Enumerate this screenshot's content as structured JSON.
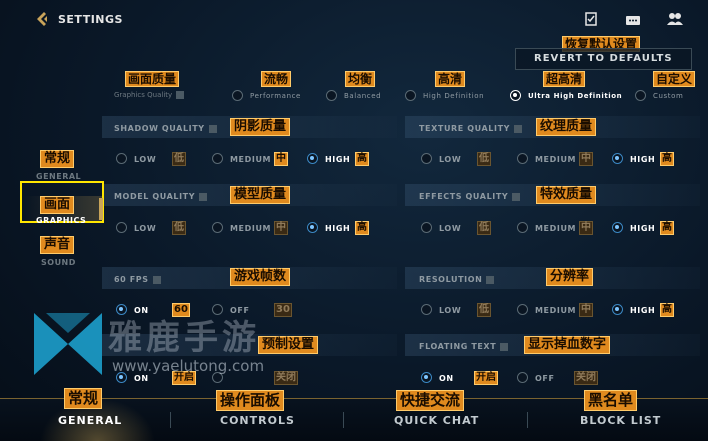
{
  "header": {
    "title": "SETTINGS",
    "revert_label": "REVERT TO DEFAULTS",
    "revert_zh": "恢复默认设置",
    "icons": [
      "checklist-icon",
      "chat-icon",
      "friends-icon"
    ]
  },
  "graphics_quality": {
    "zh": "画面质量",
    "en": "Graphics Quality",
    "options": [
      {
        "zh": "流畅",
        "en": "Performance"
      },
      {
        "zh": "均衡",
        "en": "Balanced"
      },
      {
        "zh": "高清",
        "en": "High Definition"
      },
      {
        "zh": "超高清",
        "en": "Ultra High Definition"
      },
      {
        "zh": "自定义",
        "en": "Custom"
      }
    ],
    "selected": "Ultra High Definition"
  },
  "levels": {
    "low": "LOW",
    "medium": "MEDIUM",
    "high": "HIGH",
    "low_zh": "低",
    "medium_zh": "中",
    "high_zh": "高"
  },
  "shadow": {
    "en": "SHADOW QUALITY",
    "zh": "阴影质量"
  },
  "texture": {
    "en": "TEXTURE QUALITY",
    "zh": "纹理质量"
  },
  "model": {
    "en": "MODEL QUALITY",
    "zh": "模型质量"
  },
  "effects": {
    "en": "EFFECTS QUALITY",
    "zh": "特效质量"
  },
  "fps": {
    "en": "60 FPS",
    "zh": "游戏帧数",
    "on": "ON",
    "on_zh": "60",
    "off": "OFF",
    "off_zh": "30"
  },
  "resolution": {
    "en": "RESOLUTION",
    "zh": "分辨率"
  },
  "preset": {
    "zh": "预制设置",
    "on": "ON",
    "on_zh": "开启",
    "off_zh": "关闭"
  },
  "floating": {
    "en": "FLOATING TEXT",
    "zh": "显示掉血数字",
    "on": "ON",
    "on_zh": "开启",
    "off": "OFF",
    "off_zh": "关闭"
  },
  "sidebar": {
    "general_zh": "常规",
    "general_en": "GENERAL",
    "graphics_zh": "画面",
    "graphics_en": "GRAPHICS",
    "sound_zh": "声音",
    "sound_en": "SOUND"
  },
  "bottom_tabs": [
    {
      "zh": "常规",
      "en": "GENERAL"
    },
    {
      "zh": "操作面板",
      "en": "CONTROLS"
    },
    {
      "zh": "快捷交流",
      "en": "QUICK CHAT"
    },
    {
      "zh": "黑名单",
      "en": "BLOCK LIST"
    }
  ],
  "watermark": {
    "brand": "雅鹿手游",
    "url": "www.yaelutong.com"
  },
  "colors": {
    "accent_orange": "#e08a1e",
    "highlight_yellow": "#ffe600",
    "radio_blue": "#3b88c4"
  }
}
